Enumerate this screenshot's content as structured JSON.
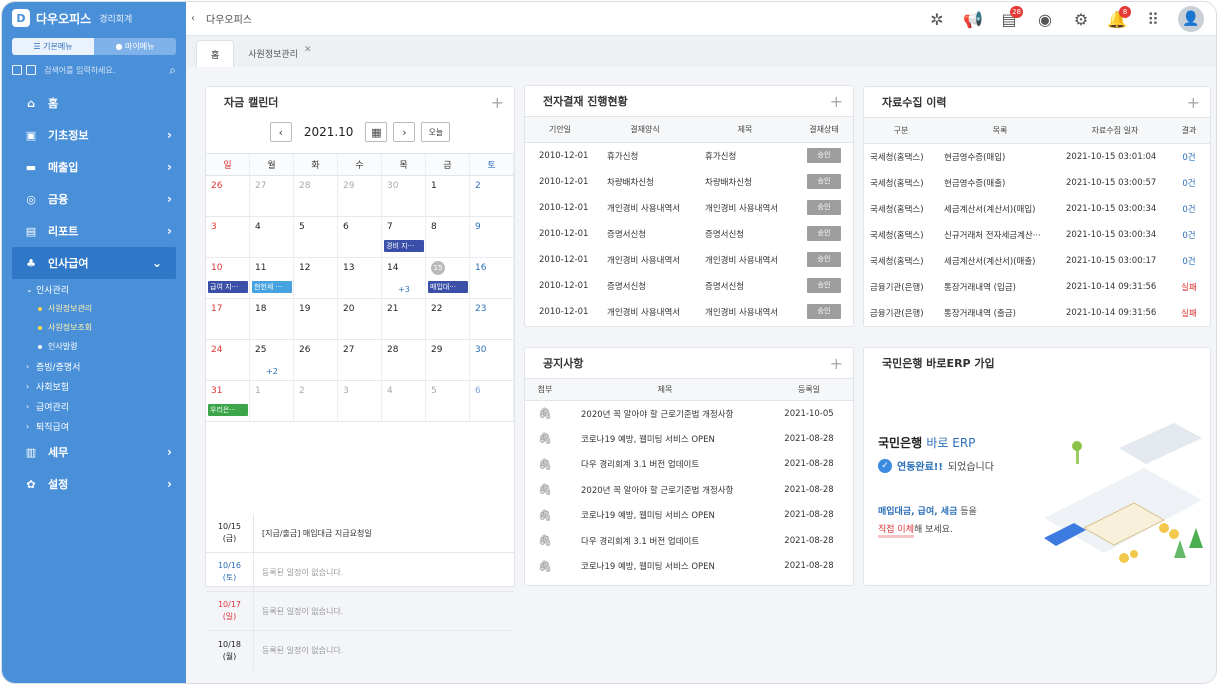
{
  "sidebar": {
    "logo_title": "다우오피스",
    "logo_sub": "경리회계",
    "toggle_basic": "☰ 기본메뉴",
    "toggle_my": "● 마이메뉴",
    "search_placeholder": "검색어를 입력하세요.",
    "items": [
      {
        "label": "홈",
        "icon": "⌂"
      },
      {
        "label": "기초정보",
        "icon": "▣"
      },
      {
        "label": "매출입",
        "icon": "▬"
      },
      {
        "label": "금융",
        "icon": "◎"
      },
      {
        "label": "리포트",
        "icon": "▤"
      },
      {
        "label": "인사급여",
        "icon": "♣"
      },
      {
        "label": "세무",
        "icon": "▥"
      },
      {
        "label": "설정",
        "icon": "✿"
      }
    ],
    "sub_hr": "인사관리",
    "sub_hr_items": [
      "사원정보관리",
      "사원정보조회",
      "인사발령"
    ],
    "sub_groups": [
      "증빙/증명서",
      "사회보험",
      "급여관리",
      "퇴직급여"
    ]
  },
  "topbar": {
    "crumb": "다우오피스",
    "badge_doc": "28",
    "badge_bell": "8"
  },
  "tabs": {
    "home": "홈",
    "emp": "사원정보관리"
  },
  "calendar": {
    "title": "자금 캘린더",
    "month": "2021.10",
    "today_btn": "오늘",
    "dow": [
      "일",
      "월",
      "화",
      "수",
      "목",
      "금",
      "토"
    ],
    "weeks": [
      [
        "26",
        "27",
        "28",
        "29",
        "30",
        "1",
        "2"
      ],
      [
        "3",
        "4",
        "5",
        "6",
        "7",
        "8",
        "9"
      ],
      [
        "10",
        "11",
        "12",
        "13",
        "14",
        "15",
        "16"
      ],
      [
        "17",
        "18",
        "19",
        "20",
        "21",
        "22",
        "23"
      ],
      [
        "24",
        "25",
        "26",
        "27",
        "28",
        "29",
        "30"
      ],
      [
        "31",
        "1",
        "2",
        "3",
        "4",
        "5",
        "6"
      ]
    ],
    "events": {
      "e1": "경비 지···",
      "e2": "급여 지···",
      "e3": "현헌세 ···",
      "e4": "매입대···",
      "e5": "우리은···",
      "more1": "+3",
      "more2": "+2"
    },
    "schedule": [
      {
        "d": "10/15",
        "w": "(금)",
        "text": "[지급/출금] 매입대금 지급요청일"
      },
      {
        "d": "10/16",
        "w": "(토)",
        "text": "등록된 일정이 없습니다."
      },
      {
        "d": "10/17",
        "w": "(일)",
        "text": "등록된 일정이 없습니다."
      },
      {
        "d": "10/18",
        "w": "(월)",
        "text": "등록된 일정이 없습니다."
      }
    ],
    "colors": {
      "navy": "#3b4fa8",
      "blue": "#2f6fd0",
      "sky": "#46a3e0",
      "green": "#3ca54a"
    }
  },
  "approval": {
    "title": "전자결재 진행현황",
    "headers": [
      "기안일",
      "결재양식",
      "제목",
      "결재상태"
    ],
    "rows": [
      [
        "2010-12-01",
        "휴가신청",
        "휴가신청",
        "승인"
      ],
      [
        "2010-12-01",
        "차량배차신청",
        "차량배차신청",
        "승인"
      ],
      [
        "2010-12-01",
        "개인경비 사용내역서",
        "개인경비 사용내역서",
        "승인"
      ],
      [
        "2010-12-01",
        "증명서신청",
        "증명서신청",
        "승인"
      ],
      [
        "2010-12-01",
        "개인경비 사용내역서",
        "개인경비 사용내역서",
        "승인"
      ],
      [
        "2010-12-01",
        "증명서신청",
        "증명서신청",
        "승인"
      ],
      [
        "2010-12-01",
        "개인경비 사용내역서",
        "개인경비 사용내역서",
        "승인"
      ]
    ]
  },
  "collect": {
    "title": "자료수집 이력",
    "headers": [
      "구분",
      "목록",
      "자료수집 일자",
      "결과"
    ],
    "rows": [
      [
        "국세청(홈택스)",
        "현금영수증(매입)",
        "2021-10-15 03:01:04",
        "0건",
        "blue"
      ],
      [
        "국세청(홈택스)",
        "현금영수증(매출)",
        "2021-10-15 03:00:57",
        "0건",
        "blue"
      ],
      [
        "국세청(홈택스)",
        "세금계산서(계산서)(매입)",
        "2021-10-15 03:00:34",
        "0건",
        "blue"
      ],
      [
        "국세청(홈택스)",
        "신규거래처 전자세금계산···",
        "2021-10-15 03:00:34",
        "0건",
        "blue"
      ],
      [
        "국세청(홈택스)",
        "세금계산서(계산서)(매출)",
        "2021-10-15 03:00:17",
        "0건",
        "blue"
      ],
      [
        "금융기관(은행)",
        "통장거래내역 (입금)",
        "2021-10-14 09:31:56",
        "실패",
        "red"
      ],
      [
        "금융기관(은행)",
        "통장거래내역 (출금)",
        "2021-10-14 09:31:56",
        "실패",
        "red"
      ]
    ]
  },
  "notice": {
    "title": "공지사항",
    "headers": [
      "첨부",
      "제목",
      "등록일"
    ],
    "rows": [
      [
        "2020년 꼭 알아야 할 근로기준법 개정사항",
        "2021-10-05"
      ],
      [
        "코로나19 예방, 웹미팅 서비스 OPEN",
        "2021-08-28"
      ],
      [
        "다우 경리회계 3.1 버전 업데이트",
        "2021-08-28"
      ],
      [
        "2020년 꼭 알아야 할 근로기준법 개정사항",
        "2021-08-28"
      ],
      [
        "코로나19 예방, 웹미팅 서비스 OPEN",
        "2021-08-28"
      ],
      [
        "다우 경리회계 3.1 버전 업데이트",
        "2021-08-28"
      ],
      [
        "코로나19 예방, 웹미팅 서비스 OPEN",
        "2021-08-28"
      ]
    ]
  },
  "ad": {
    "title": "국민은행 바로ERP 가입",
    "l1a": "국민은행 ",
    "l1b": "바로 ERP",
    "l2a": "연동완료!!",
    "l2b": " 되었습니다",
    "l3a": "매입대금, 급여, 세금",
    "l3b": " 등을",
    "l4a": "직접 이체",
    "l4b": "해 보세요."
  }
}
